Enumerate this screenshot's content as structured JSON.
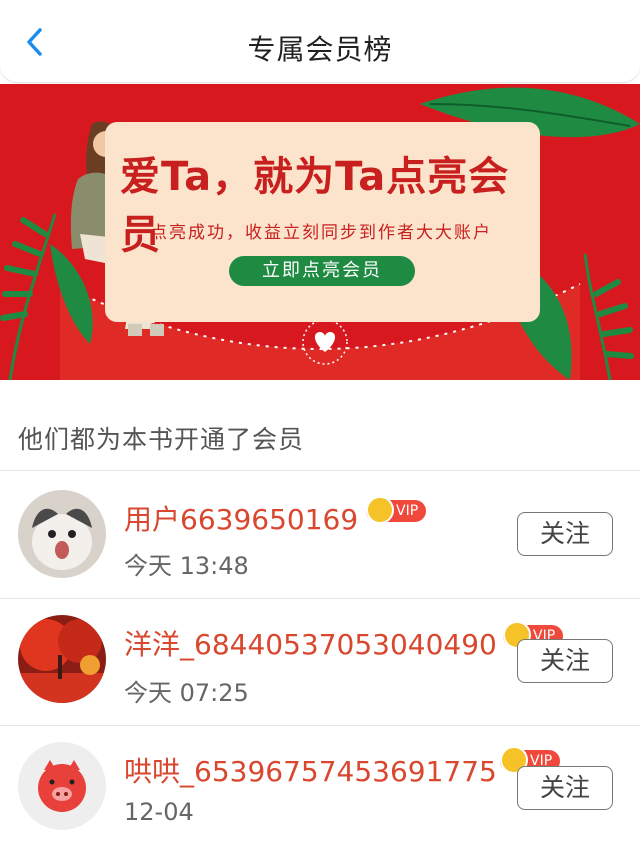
{
  "nav": {
    "title": "专属会员榜"
  },
  "banner": {
    "headline": "爱Ta，就为Ta点亮会员",
    "subtitle": "点亮成功，收益立刻同步到作者大大账户",
    "cta": "立即点亮会员"
  },
  "section": {
    "heading": "他们都为本书开通了会员"
  },
  "members": [
    {
      "name": "用户6639650169",
      "time": "今天 13:48",
      "vip": "VIP",
      "follow": "关注"
    },
    {
      "name": "洋洋_68440537053040490",
      "time": "今天 07:25",
      "vip": "VIP",
      "follow": "关注"
    },
    {
      "name": "哄哄_65396757453691775",
      "time": "12-04",
      "vip": "VIP",
      "follow": "关注"
    }
  ],
  "colors": {
    "accent": "#d9472f",
    "banner_red": "#d7191f",
    "cta_green": "#1f8b42",
    "back_blue": "#1a8cf0"
  }
}
